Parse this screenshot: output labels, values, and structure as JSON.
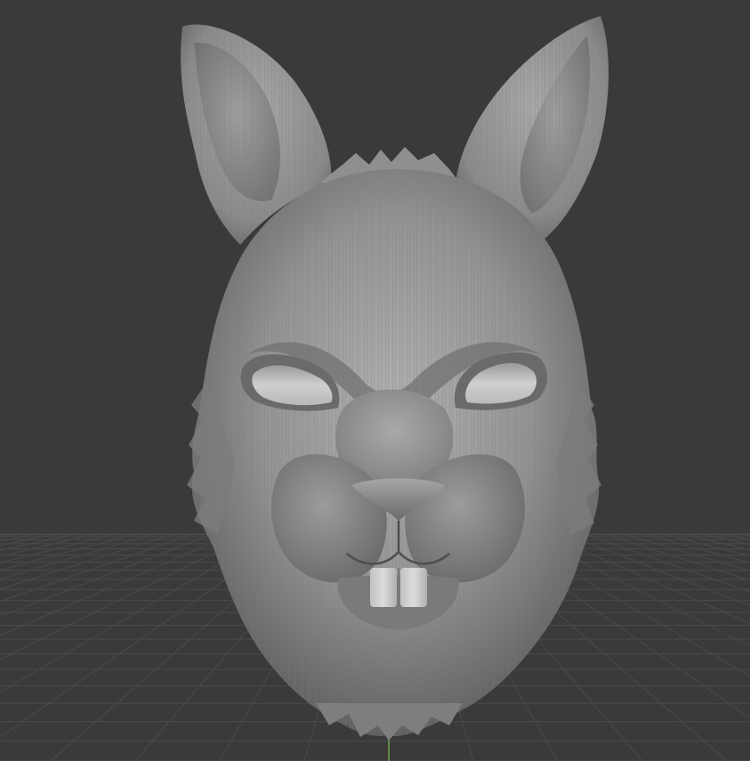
{
  "viewport": {
    "background_color": "#3a3a3a",
    "grid_line_color": "#4a4a4a",
    "grid_highlight_color": "#555555",
    "axis_color": "#6fa84a",
    "model_base_color": "#8e8e8e",
    "model_light_color": "#b4b4b4",
    "model_shadow_color": "#5a5a5a",
    "eye_opening_color": "#c8c8c8",
    "teeth_color": "#d4d4d4"
  },
  "scene": {
    "model_subject": "rabbit-mask-sculpt",
    "grid_visible": true,
    "axis_visible": true
  }
}
